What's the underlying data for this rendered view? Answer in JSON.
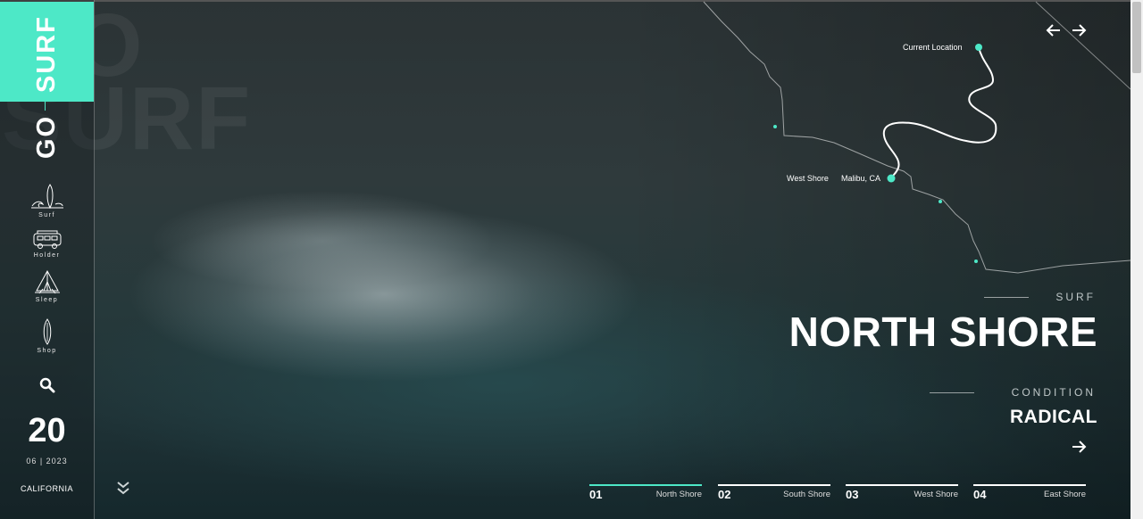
{
  "brand": {
    "word_go": "GO",
    "word_surf": "SURF",
    "ghost_text": "GO SURF",
    "accent": "#4de8c7"
  },
  "sidebar": {
    "items": [
      {
        "label": "Surf",
        "icon": "surfboard-wave-icon"
      },
      {
        "label": "Holder",
        "icon": "van-icon"
      },
      {
        "label": "Sleep",
        "icon": "tent-icon"
      },
      {
        "label": "Shop",
        "icon": "surfboard-icon"
      }
    ],
    "search_icon": "search-icon",
    "date": {
      "day": "20",
      "month_year": "06 | 2023"
    },
    "location": "CALIFORNIA",
    "scroll_icon": "chevrons-down-icon"
  },
  "map": {
    "current_location": "Current Location",
    "west_shore": "West Shore",
    "malibu": "Malibu, CA"
  },
  "nav_arrows": {
    "prev_icon": "arrow-left-icon",
    "next_icon": "arrow-right-icon"
  },
  "info": {
    "eyebrow": "SURF",
    "title": "NORTH SHORE",
    "condition_label": "CONDITION",
    "condition_value": "RADICAL",
    "next_icon": "arrow-right-icon"
  },
  "slides": [
    {
      "num": "01",
      "name": "North Shore",
      "active": true
    },
    {
      "num": "02",
      "name": "South Shore",
      "active": false
    },
    {
      "num": "03",
      "name": "West Shore",
      "active": false
    },
    {
      "num": "04",
      "name": "East Shore",
      "active": false
    }
  ]
}
